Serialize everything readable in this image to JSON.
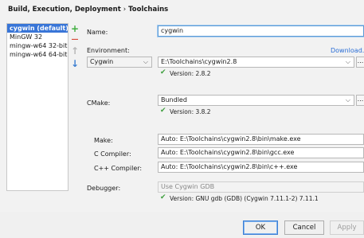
{
  "breadcrumb": {
    "parent": "Build, Execution, Deployment",
    "separator": "›",
    "current": "Toolchains"
  },
  "toolchains": {
    "items": [
      {
        "label": "cygwin (default)"
      },
      {
        "label": "MinGW 32"
      },
      {
        "label": "mingw-w64 32-bit"
      },
      {
        "label": "mingw-w64 64-bit"
      }
    ],
    "selected_index": 0
  },
  "icons": {
    "add": "+",
    "remove": "—",
    "move_up": "↑",
    "move_down": "↓",
    "checkmark": "✔",
    "chevron": "⌵",
    "ellipsis": "..."
  },
  "form": {
    "name_label": "Name:",
    "name_value": "cygwin",
    "environment_label": "Environment:",
    "download_link": "Download...",
    "environment_type": "Cygwin",
    "environment_path": "E:\\Toolchains\\cygwin2.8",
    "environment_version": "Version: 2.8.2",
    "cmake_label": "CMake:",
    "cmake_value": "Bundled",
    "cmake_version": "Version: 3.8.2",
    "make_label": "Make:",
    "make_value": "Auto: E:\\Toolchains\\cygwin2.8\\bin\\make.exe",
    "c_compiler_label": "C Compiler:",
    "c_compiler_value": "Auto: E:\\Toolchains\\cygwin2.8\\bin\\gcc.exe",
    "cpp_compiler_label": "C++ Compiler:",
    "cpp_compiler_value": "Auto: E:\\Toolchains\\cygwin2.8\\bin\\c++.exe",
    "debugger_label": "Debugger:",
    "debugger_value": "Use Cygwin GDB",
    "debugger_version": "Version: GNU gdb (GDB) (Cygwin 7.11.1-2) 7.11.1"
  },
  "buttons": {
    "ok": "OK",
    "cancel": "Cancel",
    "apply": "Apply"
  },
  "colors": {
    "selection": "#3875d7",
    "add_green": "#3fae3f",
    "remove_red": "#d84a3a",
    "move_up_gray": "#b5b5b5",
    "move_down_blue": "#3d7fd1",
    "check_green": "#3f9f3f",
    "link_blue": "#2a6ed6"
  }
}
